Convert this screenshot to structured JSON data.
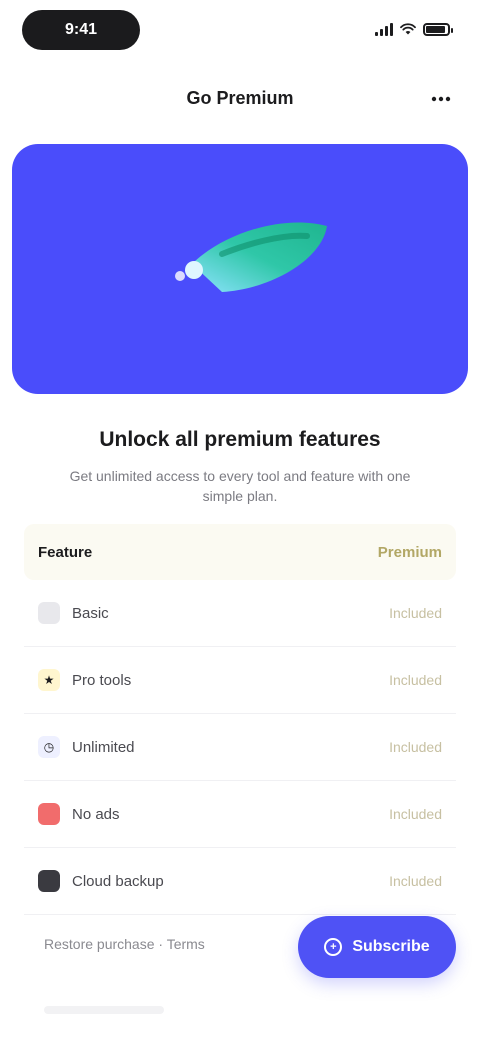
{
  "status_bar": {
    "time": "9:41",
    "icons": [
      "signal-icon",
      "wifi-icon",
      "battery-icon"
    ],
    "battery_level": 0.9
  },
  "nav": {
    "title": "Go Premium",
    "action_icon": "more-icon"
  },
  "hero": {
    "background": "#4a4dfb",
    "art_icon": "rocket-icon"
  },
  "headline": "Unlock all premium features",
  "subline": "Get unlimited access to every tool and feature with one simple plan.",
  "table": {
    "header_left": "Feature",
    "header_right": "Premium",
    "rows": [
      {
        "icon": "",
        "icon_name": "check-icon",
        "icon_color": "#e8e8ec",
        "label": "Basic",
        "value": "Included"
      },
      {
        "icon": "★",
        "icon_name": "star-icon",
        "icon_color": "#fff6cf",
        "label": "Pro tools",
        "value": "Included"
      },
      {
        "icon": "◷",
        "icon_name": "clock-icon",
        "icon_color": "#eef0ff",
        "label": "Unlimited",
        "value": "Included"
      },
      {
        "icon": "",
        "icon_name": "red-square-icon",
        "icon_color": "#f16c6c",
        "label": "No ads",
        "value": "Included"
      },
      {
        "icon": "",
        "icon_name": "dark-square-icon",
        "icon_color": "#3a3a40",
        "label": "Cloud backup",
        "value": "Included"
      }
    ]
  },
  "footer_link": "Restore purchase · Terms",
  "cta": {
    "label": "Subscribe",
    "icon": "+"
  }
}
